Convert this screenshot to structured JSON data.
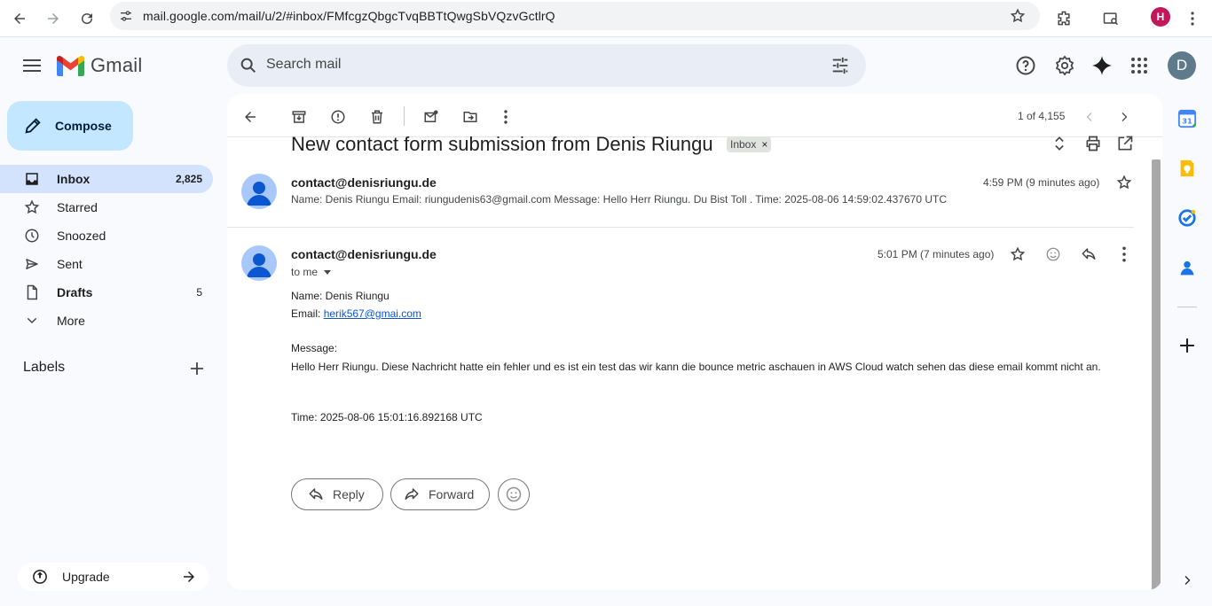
{
  "browser": {
    "url": "mail.google.com/mail/u/2/#inbox/FMfcgzQbgcTvqBBTtQwgSbVQzvGctlrQ",
    "profile_initial": "H"
  },
  "header": {
    "app_name": "Gmail",
    "search_placeholder": "Search mail",
    "account_initial": "D"
  },
  "sidebar": {
    "compose_label": "Compose",
    "items": [
      {
        "label": "Inbox",
        "count": "2,825",
        "icon": "inbox-icon"
      },
      {
        "label": "Starred",
        "count": "",
        "icon": "star-icon"
      },
      {
        "label": "Snoozed",
        "count": "",
        "icon": "clock-icon"
      },
      {
        "label": "Sent",
        "count": "",
        "icon": "send-icon"
      },
      {
        "label": "Drafts",
        "count": "5",
        "icon": "draft-icon"
      },
      {
        "label": "More",
        "count": "",
        "icon": "chevron-down-icon"
      }
    ],
    "labels_title": "Labels",
    "upgrade_label": "Upgrade"
  },
  "toolbar": {
    "pager": "1 of 4,155"
  },
  "thread": {
    "subject": "New contact form submission from Denis Riungu",
    "label_chip": "Inbox",
    "messages": [
      {
        "sender": "contact@denisriungu.de",
        "time": "4:59 PM (9 minutes ago)",
        "snippet": "Name: Denis Riungu Email: riungudenis63@gmail.com Message: Hello Herr Riungu. Du Bist Toll . Time: 2025-08-06 14:59:02.437670 UTC"
      },
      {
        "sender": "contact@denisriungu.de",
        "recipient": "to me",
        "time": "5:01 PM (7 minutes ago)",
        "body": {
          "name_line": "Name: Denis Riungu",
          "email_prefix": "Email: ",
          "email_link": "herik567@gmai.com",
          "message_label": "Message:",
          "message_text": "Hello Herr Riungu. Diese Nachricht hatte ein fehler und es ist ein test das wir kann die bounce metric aschauen in AWS Cloud watch sehen das diese email kommt nicht an.",
          "time_line": "Time: 2025-08-06 15:01:16.892168 UTC"
        }
      }
    ],
    "reply_label": "Reply",
    "forward_label": "Forward"
  },
  "colors": {
    "accent": "#0b57d0",
    "compose_bg": "#c2e7ff",
    "active_nav": "#d3e3fd",
    "avatar": "#a8c7fa"
  }
}
